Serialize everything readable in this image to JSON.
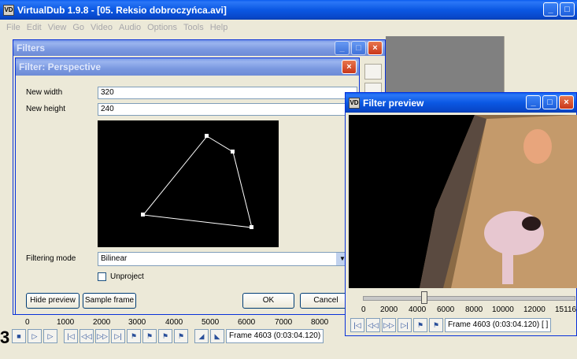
{
  "main": {
    "title": "VirtualDub 1.9.8 - [05. Reksio dobroczyńca.avi]",
    "menu": [
      "File",
      "Edit",
      "View",
      "Go",
      "Video",
      "Audio",
      "Options",
      "Tools",
      "Help"
    ],
    "timeline_ticks": [
      "0",
      "1000",
      "2000",
      "3000",
      "4000",
      "5000",
      "6000",
      "7000",
      "8000"
    ],
    "frame_text": "Frame 4603 (0:03:04.120)",
    "side_number": "3"
  },
  "filters": {
    "title": "Filters"
  },
  "perspective": {
    "title": "Filter: Perspective",
    "new_width_label": "New width",
    "new_width_value": "320",
    "new_height_label": "New height",
    "new_height_value": "240",
    "filtering_mode_label": "Filtering mode",
    "filtering_mode_value": "Bilinear",
    "unproject_label": "Unproject",
    "unproject_checked": false,
    "hide_preview_label": "Hide preview",
    "sample_frame_label": "Sample frame",
    "ok_label": "OK",
    "cancel_label": "Cancel"
  },
  "preview": {
    "title": "Filter preview",
    "ticks": [
      "0",
      "2000",
      "4000",
      "6000",
      "8000",
      "10000",
      "12000",
      "15116"
    ],
    "frame_text": "Frame 4603 (0:03:04.120) [ ]"
  },
  "colors": {
    "titlebar_active": "#0b58e3",
    "window_bg": "#ece9d8",
    "close_red": "#c9371a"
  }
}
